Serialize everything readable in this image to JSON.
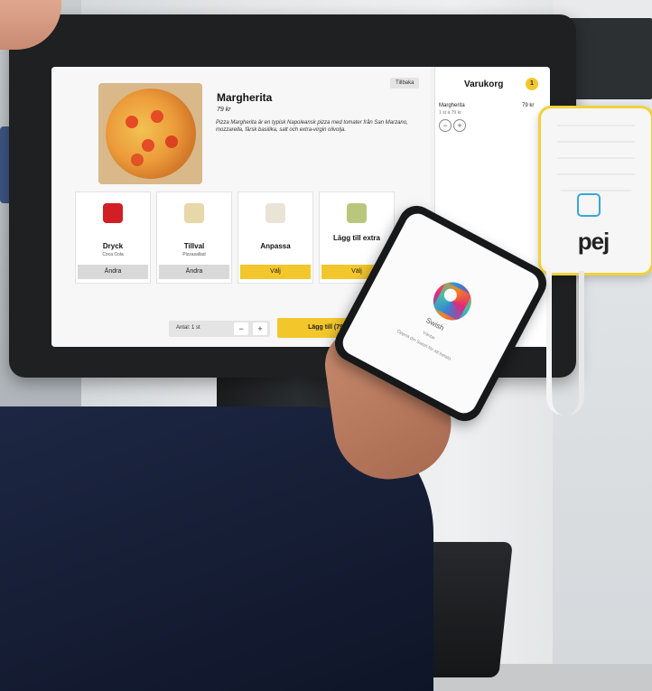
{
  "menu": {
    "back_label": "Tillbaka",
    "title": "Margherita",
    "price": "79 kr",
    "description": "Pizza Margherita är en typisk Napoleansk pizza med tomater från San Marzano, mozzarella, färsk basilika, salt och extra-virgin olivolja."
  },
  "options": [
    {
      "label": "Dryck",
      "sub": "Coca Cola",
      "button": "Ändra",
      "icon": "cola-can-icon",
      "icon_color": "#d21f26"
    },
    {
      "label": "Tillval",
      "sub": "Pizzasallad",
      "button": "Ändra",
      "icon": "salad-icon",
      "icon_color": "#e8d7a8"
    },
    {
      "label": "Anpassa",
      "sub": "",
      "button": "Välj",
      "icon": "garlic-icon",
      "icon_color": "#e9e4d6"
    },
    {
      "label": "Lägg till extra",
      "sub": "",
      "button": "Välj",
      "icon": "toppings-icon",
      "icon_color": "#b9c77d"
    }
  ],
  "quantity": {
    "label": "Antal: 1 st",
    "minus": "−",
    "plus": "+"
  },
  "add_button": "Lägg till (79 kr)",
  "cart": {
    "title": "Varukorg",
    "count": "1",
    "item": "Margherita",
    "item_sub": "1 st á 79 kr",
    "item_price": "79 kr",
    "minus": "−",
    "plus": "+"
  },
  "reader": {
    "brand": "pej"
  },
  "phone": {
    "app": "Swish",
    "status": "Väntar",
    "instruction": "Öppna din Swish för att betala"
  },
  "colors": {
    "accent": "#f3c72c",
    "reader_border": "#f3d13a"
  }
}
